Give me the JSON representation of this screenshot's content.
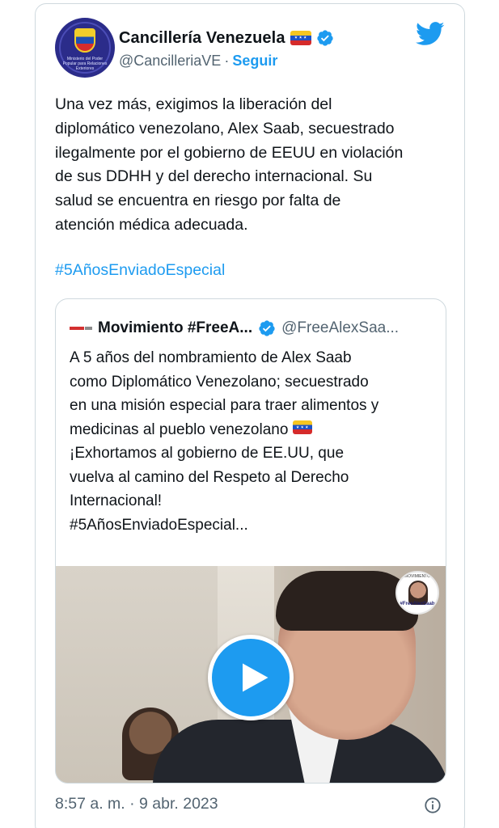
{
  "tweet": {
    "author_name": "Cancillería Venezuela",
    "handle": "@CancilleriaVE",
    "separator": "·",
    "follow_label": "Seguir",
    "avatar_caption": "Ministerio del Poder Popular para Relaciones Exteriores",
    "text": "Una vez más, exigimos la liberación del\ndiplomático venezolano, Alex Saab, secuestrado\nilegalmente por el gobierno de EEUU en violación\nde sus DDHH y del derecho internacional. Su\nsalud se encuentra en riesgo por falta de\natención médica adecuada.",
    "hashtag": "#5AñosEnviadoEspecial",
    "timestamp": "8:57 a. m. · 9 abr. 2023"
  },
  "quote": {
    "author_name": "Movimiento #FreeA...",
    "handle": "@FreeAlexSaa...",
    "lines": [
      "A 5 años del nombramiento de Alex Saab",
      "como Diplomático Venezolano; secuestrado",
      "en una misión especial para traer alimentos y",
      "medicinas al pueblo venezolano",
      "¡Exhortamos al gobierno de EE.UU, que",
      "vuelva al camino del Respeto al Derecho",
      "Internacional!",
      "#5AñosEnviadoEspecial..."
    ],
    "video_badge_top": "MOVIMIENTO",
    "video_badge_label": "#FreeAlexSaab"
  },
  "colors": {
    "accent": "#1d9bf0",
    "text_primary": "#0f1419",
    "text_secondary": "#536471",
    "border": "#cfd9de"
  },
  "icons": {
    "logo": "twitter-bird-icon",
    "verified": "verified-badge-icon",
    "play": "play-icon",
    "info": "info-icon",
    "flag": "venezuela-flag-emoji"
  }
}
